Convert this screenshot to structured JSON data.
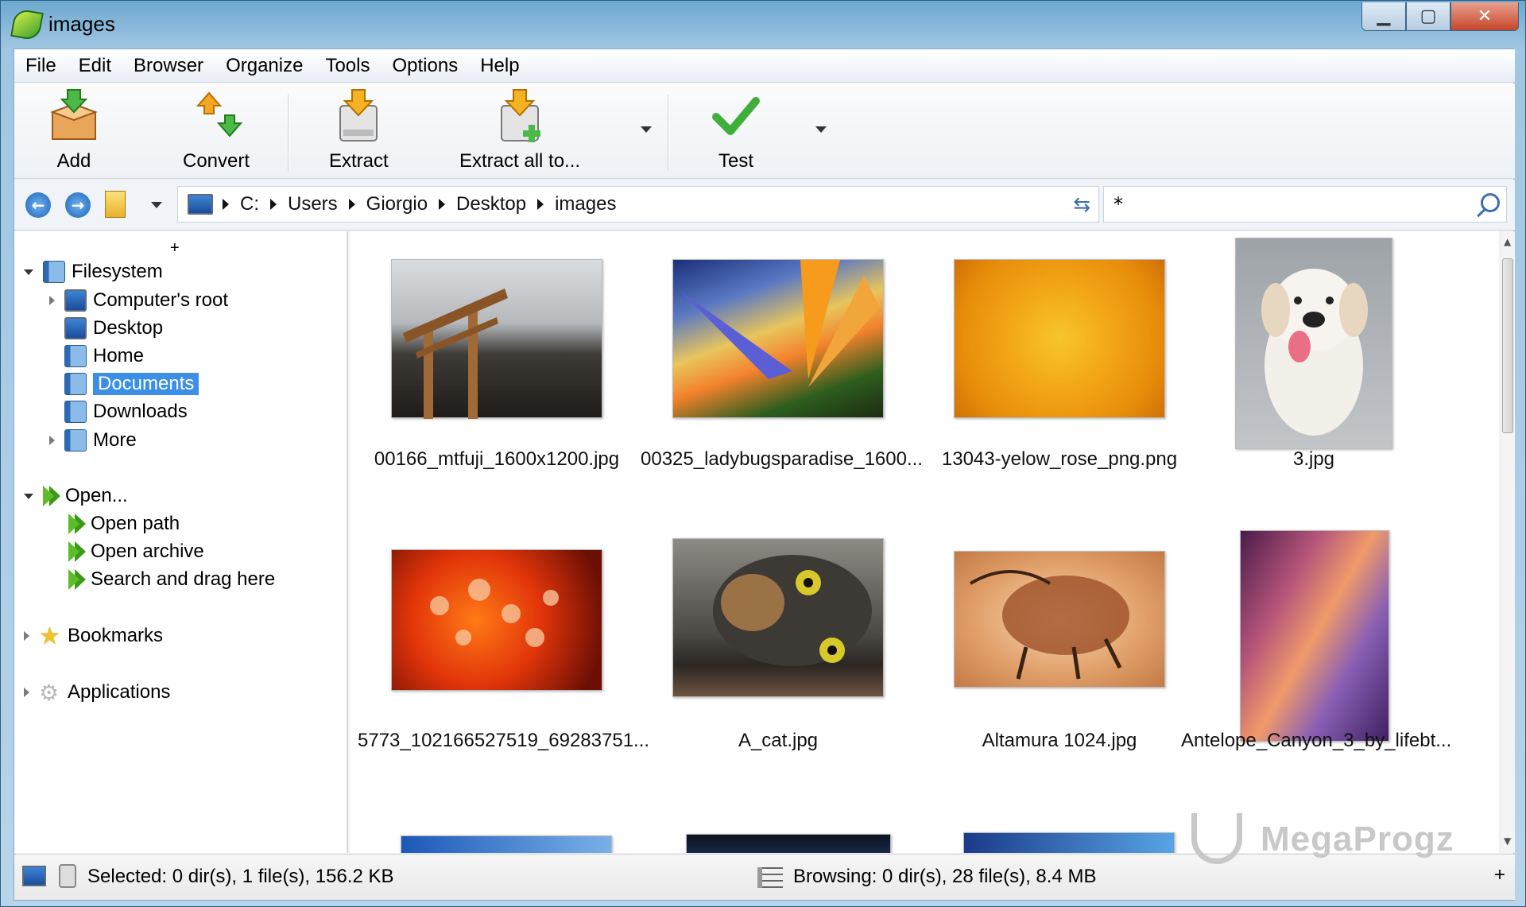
{
  "window": {
    "title": "images"
  },
  "menu": [
    "File",
    "Edit",
    "Browser",
    "Organize",
    "Tools",
    "Options",
    "Help"
  ],
  "toolbar": {
    "add": "Add",
    "convert": "Convert",
    "extract": "Extract",
    "extract_all": "Extract all to...",
    "test": "Test"
  },
  "address": {
    "crumbs": [
      "C:",
      "Users",
      "Giorgio",
      "Desktop",
      "images"
    ],
    "filter": "*"
  },
  "sidebar": {
    "plus": "+",
    "filesystem": "Filesystem",
    "computers_root": "Computer's root",
    "desktop": "Desktop",
    "home": "Home",
    "documents": "Documents",
    "downloads": "Downloads",
    "more": "More",
    "open": "Open...",
    "open_path": "Open path",
    "open_archive": "Open archive",
    "search_drag": "Search and drag here",
    "bookmarks": "Bookmarks",
    "applications": "Applications"
  },
  "files": [
    "00166_mtfuji_1600x1200.jpg",
    "00325_ladybugsparadise_1600...",
    "13043-yelow_rose_png.png",
    "3.jpg",
    "5773_102166527519_69283751...",
    "A_cat.jpg",
    "Altamura 1024.jpg",
    "Antelope_Canyon_3_by_lifebt..."
  ],
  "status": {
    "selected": "Selected: 0 dir(s), 1 file(s), 156.2 KB",
    "browsing": "Browsing: 0 dir(s), 28 file(s), 8.4 MB",
    "plus": "+"
  },
  "watermark": "MegaProgz"
}
